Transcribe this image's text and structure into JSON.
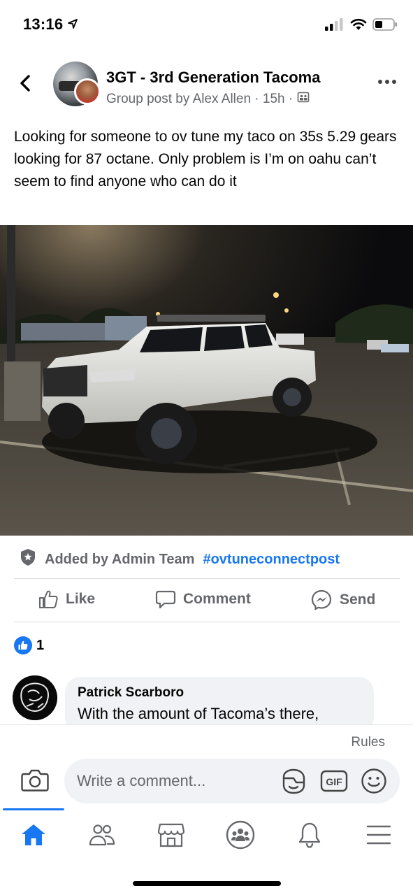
{
  "status_bar": {
    "time": "13:16",
    "signal_icon": "cellular-signal-icon",
    "wifi_icon": "wifi-icon",
    "battery_icon": "battery-icon"
  },
  "header": {
    "group_name": "3GT - 3rd Generation Tacoma",
    "meta_prefix": "Group post by Alex Allen · 15h ·",
    "privacy_icon": "group-members-icon",
    "back_icon": "chevron-left-icon",
    "more_icon": "more-horizontal-icon"
  },
  "post": {
    "text": "Looking for someone to ov tune my taco on 35s 5.29 gears looking for 87 octane. Only problem is I’m on oahu can’t seem to find anyone who can do it"
  },
  "admin": {
    "label": "Added by Admin Team",
    "hashtag": "#ovtuneconnectpost",
    "icon": "admin-badge-icon"
  },
  "actions": {
    "like": "Like",
    "comment": "Comment",
    "send": "Send"
  },
  "reactions": {
    "count": "1",
    "icon": "like-reaction-icon"
  },
  "comment": {
    "author": "Patrick Scarboro",
    "text": "With the amount of Tacoma’s there,"
  },
  "composer": {
    "rules": "Rules",
    "placeholder": "Write a comment...",
    "gif_label": "GIF"
  },
  "tabs": [
    {
      "name": "home",
      "icon": "home-icon",
      "active": true
    },
    {
      "name": "friends",
      "icon": "friends-icon",
      "active": false
    },
    {
      "name": "marketplace",
      "icon": "marketplace-icon",
      "active": false
    },
    {
      "name": "groups",
      "icon": "groups-icon",
      "active": false
    },
    {
      "name": "notifications",
      "icon": "bell-icon",
      "active": false
    },
    {
      "name": "menu",
      "icon": "menu-icon",
      "active": false
    }
  ],
  "colors": {
    "brand_blue": "#1877f2",
    "secondary_text": "#65676b",
    "bubble_bg": "#f0f2f5"
  }
}
